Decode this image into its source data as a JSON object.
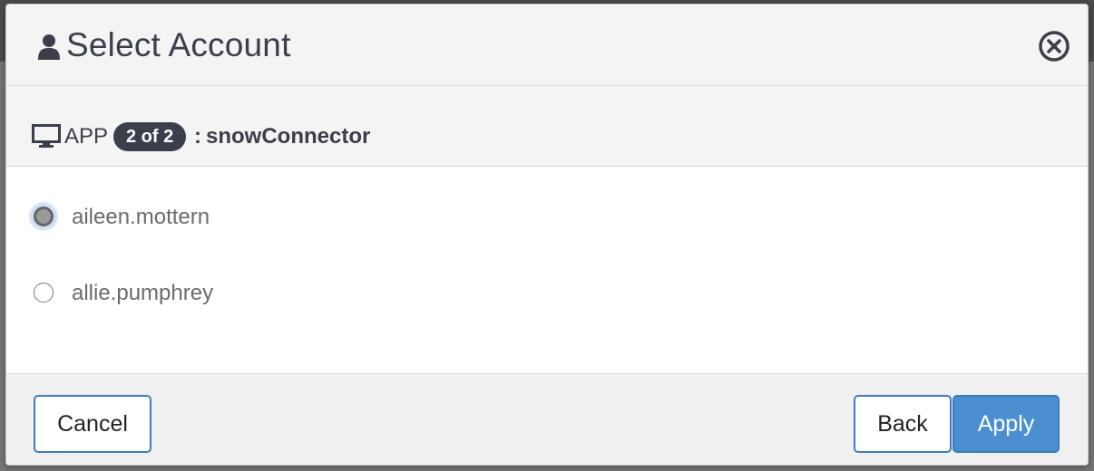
{
  "dialog": {
    "title": "Select Account",
    "close_icon": "close-circle-icon",
    "user_icon": "user-icon"
  },
  "app_row": {
    "icon": "monitor-icon",
    "label": "APP",
    "badge": "2 of 2",
    "separator": ":",
    "name": "snowConnector"
  },
  "accounts": [
    {
      "label": "aileen.mottern",
      "selected": true
    },
    {
      "label": "allie.pumphrey",
      "selected": false
    }
  ],
  "footer": {
    "cancel_label": "Cancel",
    "back_label": "Back",
    "apply_label": "Apply"
  },
  "colors": {
    "primary": "#4b8fd1",
    "dark_text": "#3a3f4b",
    "badge_bg": "#3a3f4b"
  }
}
